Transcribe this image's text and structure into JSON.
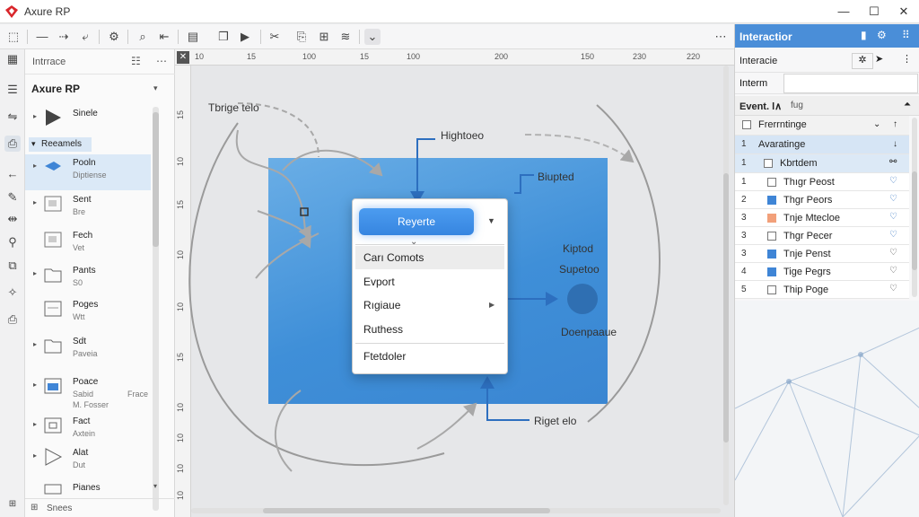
{
  "window": {
    "title": "Axure RP",
    "minimize": "—",
    "maximize": "☐",
    "close": "✕"
  },
  "left_panel": {
    "header_label": "Intrrace",
    "title": "Axure RP",
    "section_label": "Reeamels",
    "items": [
      {
        "label": "Sinele",
        "sub": ""
      },
      {
        "label": "Pooln",
        "sub": "Diptiense"
      },
      {
        "label": "Sent",
        "sub": "Bre"
      },
      {
        "label": "Fech",
        "sub": "Vet"
      },
      {
        "label": "Pants",
        "sub": "S0"
      },
      {
        "label": "Poges",
        "sub": "Wtt"
      },
      {
        "label": "Sdt",
        "sub": "Paveia"
      },
      {
        "label": "Poace",
        "sub": "Sabid",
        "sub2": "Frace",
        "sub3": "M. Fosser"
      },
      {
        "label": "Fact",
        "sub": "Axtein"
      },
      {
        "label": "Alat",
        "sub": "Dut"
      },
      {
        "label": "Pianes",
        "sub": ""
      }
    ],
    "footer_label": "Snees"
  },
  "canvas": {
    "ruler_top": [
      "10",
      "15",
      "100",
      "15",
      "100",
      "200",
      "150",
      "230",
      "220"
    ],
    "ruler_left": [
      "15",
      "10",
      "15",
      "10",
      "10",
      "15",
      "10",
      "10",
      "10",
      "10"
    ],
    "labels": {
      "top_left": "Tbrige telo",
      "arrow_top": "Hightoeo",
      "right_upper": "Biupted",
      "right_mid": "Kiptod",
      "circle_label": "Supetoo",
      "circle_bottom": "Doenpaaue",
      "bottom": "Riget elo"
    },
    "dropdown": {
      "primary_button": "Reyerte",
      "menu": [
        "Carı Comots",
        "Evport",
        "Rıgiaue",
        "Ruthess"
      ],
      "menu_last": "Ftetdoler"
    }
  },
  "right_panel": {
    "header": "Interactior",
    "row1_label": "Interacie",
    "row2_label": "Interm",
    "events_label": "Event. l∧",
    "events_tab": "fug",
    "group1": "Frerrntinge",
    "group2": "Avaratinge",
    "sub_header": "Kbrtdem",
    "events": [
      {
        "num": "1",
        "label": "Thıgr Peost",
        "color": "#ffffff"
      },
      {
        "num": "2",
        "label": "Thgr Peors",
        "color": "#3f85d6"
      },
      {
        "num": "3",
        "label": "Tnje Mtecloe",
        "color": "#f2a07a"
      },
      {
        "num": "3",
        "label": "Thgr Pecer",
        "color": "#ffffff"
      },
      {
        "num": "3",
        "label": "Tnje Penst",
        "color": "#3f85d6"
      },
      {
        "num": "4",
        "label": "Tige Pegrs",
        "color": "#3f85d6"
      },
      {
        "num": "5",
        "label": "Thip Poge",
        "color": "#ffffff"
      }
    ]
  },
  "colors": {
    "accent": "#4a8ed8",
    "canvas_panel": "#4a94dd",
    "button": "#3a88e6"
  }
}
